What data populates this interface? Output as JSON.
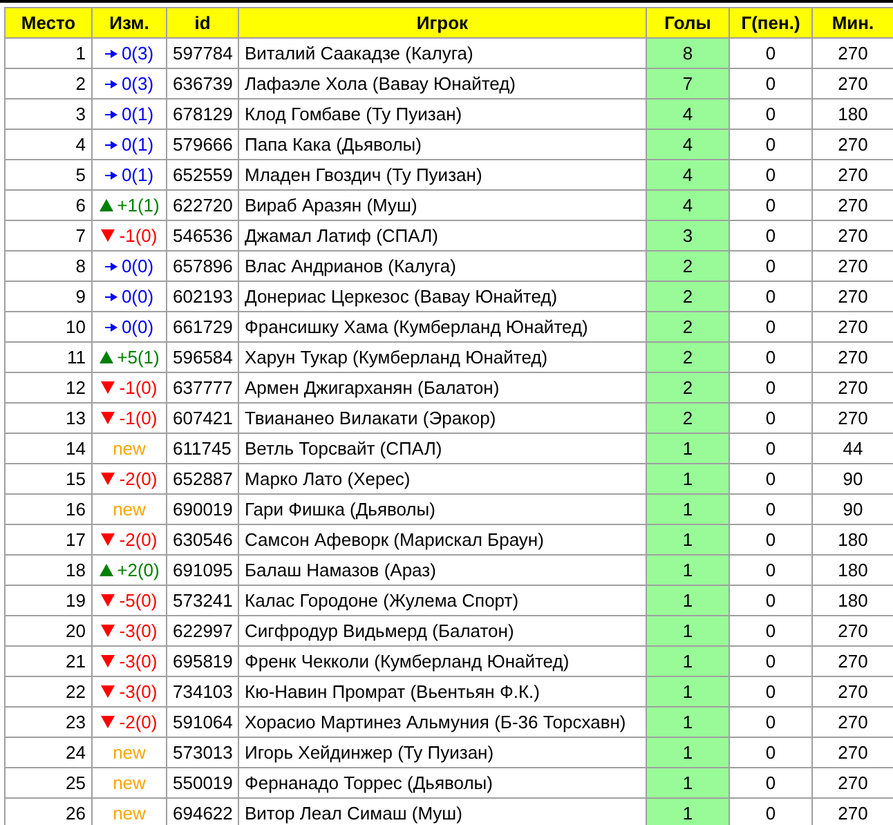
{
  "table": {
    "columns": [
      "Место",
      "Изм.",
      "id",
      "Игрок",
      "Голы",
      "Г(пен.)",
      "Мин."
    ],
    "rows": [
      {
        "place": "1",
        "kind": "same",
        "change": "0(3)",
        "id": "597784",
        "player": "Виталий Саакадзе (Калуга)",
        "goals": "8",
        "pen": "0",
        "min": "270"
      },
      {
        "place": "2",
        "kind": "same",
        "change": "0(3)",
        "id": "636739",
        "player": "Лафаэле Хола (Вавау Юнайтед)",
        "goals": "7",
        "pen": "0",
        "min": "270"
      },
      {
        "place": "3",
        "kind": "same",
        "change": "0(1)",
        "id": "678129",
        "player": "Клод Гомбаве (Ту Пуизан)",
        "goals": "4",
        "pen": "0",
        "min": "180"
      },
      {
        "place": "4",
        "kind": "same",
        "change": "0(1)",
        "id": "579666",
        "player": "Папа Кака (Дьяволы)",
        "goals": "4",
        "pen": "0",
        "min": "270"
      },
      {
        "place": "5",
        "kind": "same",
        "change": "0(1)",
        "id": "652559",
        "player": "Младен Гвоздич (Ту Пуизан)",
        "goals": "4",
        "pen": "0",
        "min": "270"
      },
      {
        "place": "6",
        "kind": "up",
        "change": "+1(1)",
        "id": "622720",
        "player": "Вираб Аразян (Муш)",
        "goals": "4",
        "pen": "0",
        "min": "270"
      },
      {
        "place": "7",
        "kind": "down",
        "change": "-1(0)",
        "id": "546536",
        "player": "Джамал Латиф (СПАЛ)",
        "goals": "3",
        "pen": "0",
        "min": "270"
      },
      {
        "place": "8",
        "kind": "same",
        "change": "0(0)",
        "id": "657896",
        "player": "Влас Андрианов (Калуга)",
        "goals": "2",
        "pen": "0",
        "min": "270"
      },
      {
        "place": "9",
        "kind": "same",
        "change": "0(0)",
        "id": "602193",
        "player": "Донериас Церкезос (Вавау Юнайтед)",
        "goals": "2",
        "pen": "0",
        "min": "270"
      },
      {
        "place": "10",
        "kind": "same",
        "change": "0(0)",
        "id": "661729",
        "player": "Франсишку Хама (Кумберланд Юнайтед)",
        "goals": "2",
        "pen": "0",
        "min": "270"
      },
      {
        "place": "11",
        "kind": "up",
        "change": "+5(1)",
        "id": "596584",
        "player": "Харун Тукар (Кумберланд Юнайтед)",
        "goals": "2",
        "pen": "0",
        "min": "270"
      },
      {
        "place": "12",
        "kind": "down",
        "change": "-1(0)",
        "id": "637777",
        "player": "Армен Джигарханян (Балатон)",
        "goals": "2",
        "pen": "0",
        "min": "270"
      },
      {
        "place": "13",
        "kind": "down",
        "change": "-1(0)",
        "id": "607421",
        "player": "Твиананео Вилакати (Эракор)",
        "goals": "2",
        "pen": "0",
        "min": "270"
      },
      {
        "place": "14",
        "kind": "new",
        "change": "new",
        "id": "611745",
        "player": "Ветль Торсвайт (СПАЛ)",
        "goals": "1",
        "pen": "0",
        "min": "44"
      },
      {
        "place": "15",
        "kind": "down",
        "change": "-2(0)",
        "id": "652887",
        "player": "Марко Лато (Херес)",
        "goals": "1",
        "pen": "0",
        "min": "90"
      },
      {
        "place": "16",
        "kind": "new",
        "change": "new",
        "id": "690019",
        "player": "Гари Фишка (Дьяволы)",
        "goals": "1",
        "pen": "0",
        "min": "90"
      },
      {
        "place": "17",
        "kind": "down",
        "change": "-2(0)",
        "id": "630546",
        "player": "Самсон Афеворк (Марискал Браун)",
        "goals": "1",
        "pen": "0",
        "min": "180"
      },
      {
        "place": "18",
        "kind": "up",
        "change": "+2(0)",
        "id": "691095",
        "player": "Балаш Намазов (Араз)",
        "goals": "1",
        "pen": "0",
        "min": "180"
      },
      {
        "place": "19",
        "kind": "down",
        "change": "-5(0)",
        "id": "573241",
        "player": "Калас Городоне (Жулема Спорт)",
        "goals": "1",
        "pen": "0",
        "min": "180"
      },
      {
        "place": "20",
        "kind": "down",
        "change": "-3(0)",
        "id": "622997",
        "player": "Сигфродур Видьмерд (Балатон)",
        "goals": "1",
        "pen": "0",
        "min": "270"
      },
      {
        "place": "21",
        "kind": "down",
        "change": "-3(0)",
        "id": "695819",
        "player": "Френк Чекколи (Кумберланд Юнайтед)",
        "goals": "1",
        "pen": "0",
        "min": "270"
      },
      {
        "place": "22",
        "kind": "down",
        "change": "-3(0)",
        "id": "734103",
        "player": "Кю-Навин Промрат (Вьентьян Ф.К.)",
        "goals": "1",
        "pen": "0",
        "min": "270"
      },
      {
        "place": "23",
        "kind": "down",
        "change": "-2(0)",
        "id": "591064",
        "player": "Хорасио Мартинез Альмуния (Б-36 Торсхавн)",
        "goals": "1",
        "pen": "0",
        "min": "270"
      },
      {
        "place": "24",
        "kind": "new",
        "change": "new",
        "id": "573013",
        "player": "Игорь Хейдинжер (Ту Пуизан)",
        "goals": "1",
        "pen": "0",
        "min": "270"
      },
      {
        "place": "25",
        "kind": "new",
        "change": "new",
        "id": "550019",
        "player": "Фернанадо Торрес (Дьяволы)",
        "goals": "1",
        "pen": "0",
        "min": "270"
      },
      {
        "place": "26",
        "kind": "new",
        "change": "new",
        "id": "694622",
        "player": "Витор Леал Симаш (Муш)",
        "goals": "1",
        "pen": "0",
        "min": "270"
      }
    ]
  }
}
